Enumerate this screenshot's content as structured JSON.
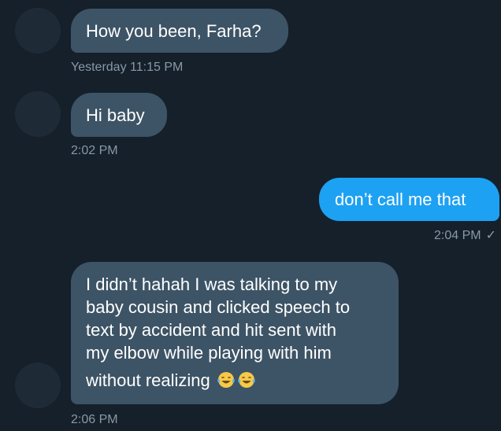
{
  "colors": {
    "background": "#15202b",
    "incoming_bubble": "#3d5466",
    "outgoing_bubble": "#1da1f2",
    "timestamp": "#8899a6",
    "avatar": "#1e2b37"
  },
  "messages": [
    {
      "direction": "incoming",
      "text": "How you been, Farha?",
      "time": "Yesterday 11:15 PM"
    },
    {
      "direction": "incoming",
      "text": "Hi baby",
      "time": "2:02 PM"
    },
    {
      "direction": "outgoing",
      "text": "don’t call me that",
      "time": "2:04 PM",
      "status_icon": "read-check-icon",
      "status_glyph": "✓"
    },
    {
      "direction": "incoming",
      "lines": [
        "I didn’t hahah I was talking to my",
        "baby cousin and clicked speech to",
        "text by accident and hit sent with",
        "my elbow while playing with him",
        "without realizing"
      ],
      "emojis": [
        "face-with-tears-of-joy-icon",
        "face-with-tears-of-joy-icon"
      ],
      "time": "2:06 PM"
    }
  ]
}
